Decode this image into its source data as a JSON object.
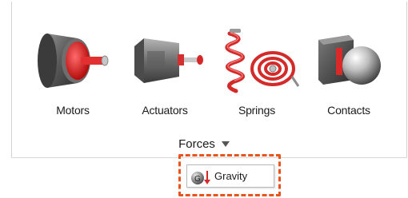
{
  "tools": [
    {
      "label": "Motors",
      "icon": "motor-icon"
    },
    {
      "label": "Actuators",
      "icon": "actuator-icon"
    },
    {
      "label": "Springs",
      "icon": "spring-icon"
    },
    {
      "label": "Contacts",
      "icon": "contact-icon"
    }
  ],
  "group": {
    "label": "Forces",
    "dropdown_icon": "caret-down-icon"
  },
  "menu": {
    "item_label": "Gravity",
    "item_icon": "gravity-icon"
  },
  "colors": {
    "accent_red": "#e02424",
    "highlight_orange": "#e8541c",
    "metal_dark": "#4a4a4a",
    "metal_light": "#c8c8c8"
  }
}
